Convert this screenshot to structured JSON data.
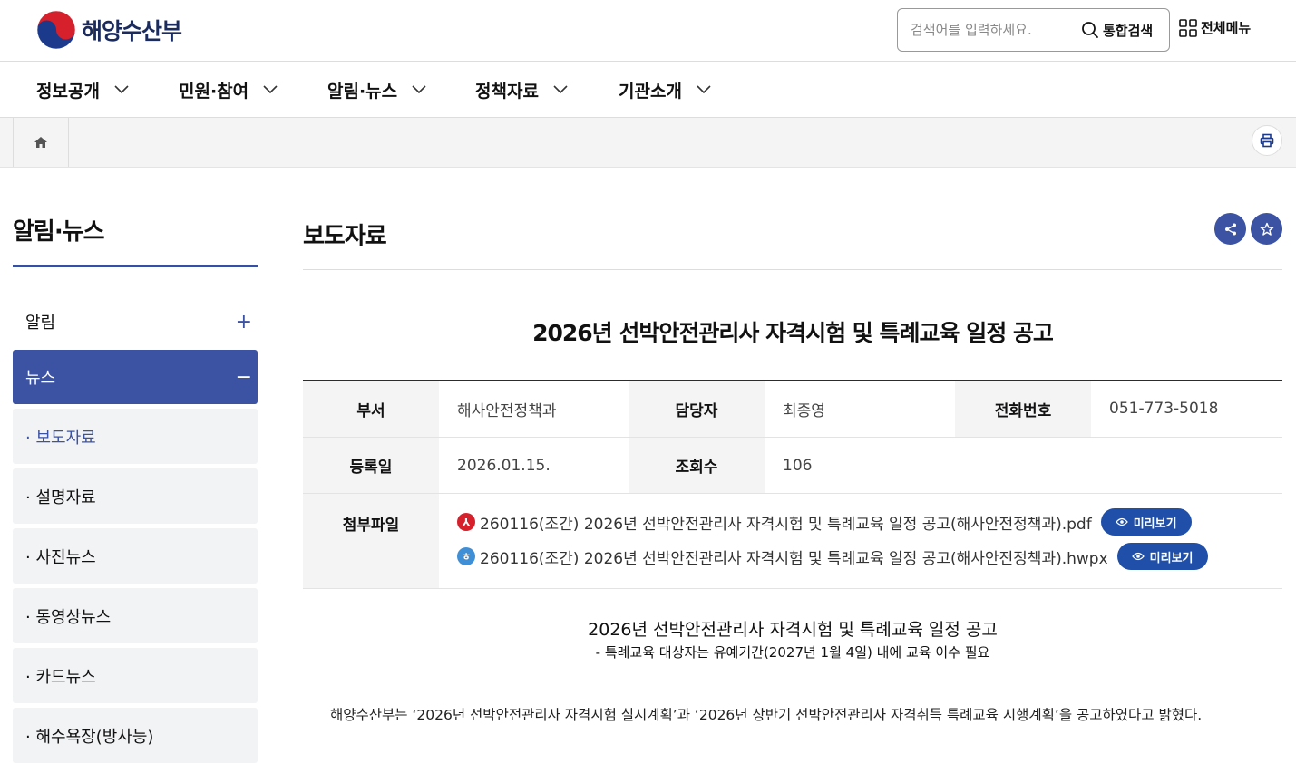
{
  "header": {
    "logo_text": "해양수산부",
    "search_placeholder": "검색어를 입력하세요.",
    "search_button": "통합검색",
    "all_menu": "전체메뉴"
  },
  "gnb": [
    {
      "label": "정보공개"
    },
    {
      "label": "민원·참여"
    },
    {
      "label": "알림·뉴스"
    },
    {
      "label": "정책자료"
    },
    {
      "label": "기관소개"
    }
  ],
  "sidebar": {
    "title": "알림·뉴스",
    "categories": [
      {
        "label": "알림",
        "toggle": "+"
      },
      {
        "label": "뉴스",
        "toggle": "−"
      }
    ],
    "subitems": [
      {
        "label": "· 보도자료"
      },
      {
        "label": "· 설명자료"
      },
      {
        "label": "· 사진뉴스"
      },
      {
        "label": "· 동영상뉴스"
      },
      {
        "label": "· 카드뉴스"
      },
      {
        "label": "· 해수욕장(방사능)"
      }
    ]
  },
  "content": {
    "page_title": "보도자료",
    "doc_title": "2026년 선박안전관리사 자격시험 및 특례교육 일정 공고",
    "info": {
      "dept_label": "부서",
      "dept_value": "해사안전정책과",
      "manager_label": "담당자",
      "manager_value": "최종영",
      "phone_label": "전화번호",
      "phone_value": "051-773-5018",
      "date_label": "등록일",
      "date_value": "2026.01.15.",
      "views_label": "조회수",
      "views_value": "106",
      "attach_label": "첨부파일"
    },
    "attachments": [
      {
        "name": "260116(조간) 2026년 선박안전관리사 자격시험 및 특례교육 일정 공고(해사안전정책과).pdf",
        "button": "미리보기"
      },
      {
        "name": "260116(조간) 2026년 선박안전관리사 자격시험 및 특례교육 일정 공고(해사안전정책과).hwpx",
        "button": "미리보기"
      }
    ],
    "body_headline": "2026년 선박안전관리사 자격시험 및 특례교육 일정 공고",
    "body_subline": "- 특례교육 대상자는 유예기간(2027년 1월 4일) 내에 교육 이수 필요",
    "body_paragraph": "해양수산부는 ‘2026년 선박안전관리사 자격시험 실시계획’과 ‘2026년 상반기 선박안전관리사 자격취득 특례교육 시행계획’을 공고하였다고 밝혔다."
  },
  "colors": {
    "accent": "#3c52a3",
    "preview_button": "#1f4fa8",
    "pdf_icon": "#d6202b",
    "hwp_icon": "#3e8fd6"
  }
}
